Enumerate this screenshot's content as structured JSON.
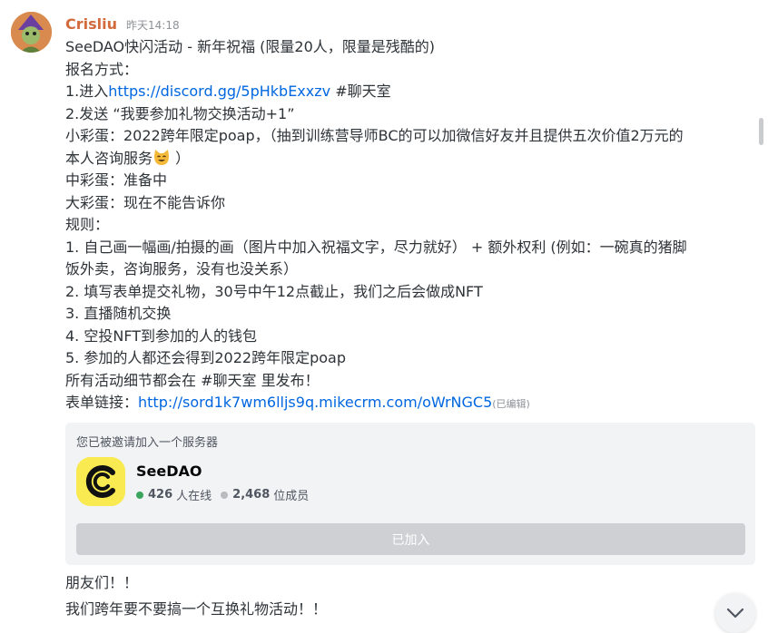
{
  "message": {
    "username": "Crisliu",
    "timestamp": "昨天14:18",
    "title": "SeeDAO快闪活动 - 新年祝福 (限量20人，限量是残酷的)",
    "signup_heading": "报名方式：",
    "step1_prefix": "1.进入",
    "step1_link": "https://discord.gg/5pHkbExxzv",
    "step1_suffix": " #聊天室",
    "step2": "2.发送 “我要参加礼物交换活动+1”",
    "small_egg_line1": "小彩蛋：2022跨年限定poap，（抽到训练营导师BC的可以加微信好友并且提供五次价值2万元的",
    "small_egg_line2_pre": "本人咨询服务",
    "small_egg_line2_post": " ）",
    "medium_egg": "中彩蛋：准备中",
    "big_egg": "大彩蛋：现在不能告诉你",
    "rules_heading": "规则：",
    "rule1_line1": "1. 自己画一幅画/拍摄的画（图片中加入祝福文字，尽力就好） + 额外权利 (例如：一碗真的猪脚",
    "rule1_line2": "饭外卖，咨询服务，没有也没关系）",
    "rule2": "2. 填写表单提交礼物，30号中午12点截止，我们之后会做成NFT",
    "rule3": "3. 直播随机交换",
    "rule4": "4. 空投NFT到参加的人的钱包",
    "rule5": "5. 参加的人都还会得到2022跨年限定poap",
    "details": "所有活动细节都会在 #聊天室 里发布！",
    "form_prefix": " 表单链接：",
    "form_link": "http://sord1k7wm6lljs9q.mikecrm.com/oWrNGC5",
    "edited_label": "(已编辑)",
    "emoji_icon": "cat-smile-emoji"
  },
  "invite": {
    "title": "您已被邀请加入一个服务器",
    "server_name": "SeeDAO",
    "online_count": "426",
    "online_label": "人在线",
    "member_count": "2,468",
    "member_label": "位成员",
    "button_label": "已加入"
  },
  "followups": [
    "朋友们！！",
    "我们跨年要不要搞一个互换礼物活动！！"
  ],
  "colors": {
    "username": "#d26a3c",
    "link": "#0067e0",
    "online": "#3ba55d",
    "server_icon_bg": "#f8ea50"
  }
}
